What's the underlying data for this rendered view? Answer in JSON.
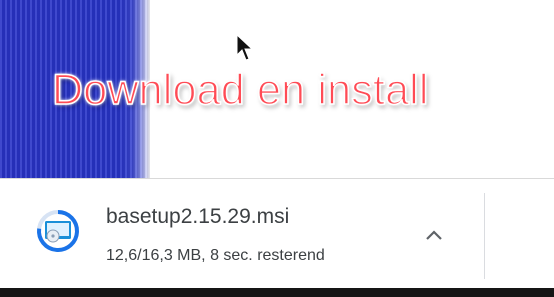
{
  "overlay": {
    "title": "Download en install",
    "title_color": "#ff4b55",
    "strip_color": "#2a34c8"
  },
  "download": {
    "filename": "basetup2.15.29.msi",
    "status": "12,6/16,3 MB, 8 sec. resterend",
    "file_icon": "installer-disc-icon",
    "options_icon": "chevron-up-icon",
    "progress_fraction": 0.77
  }
}
